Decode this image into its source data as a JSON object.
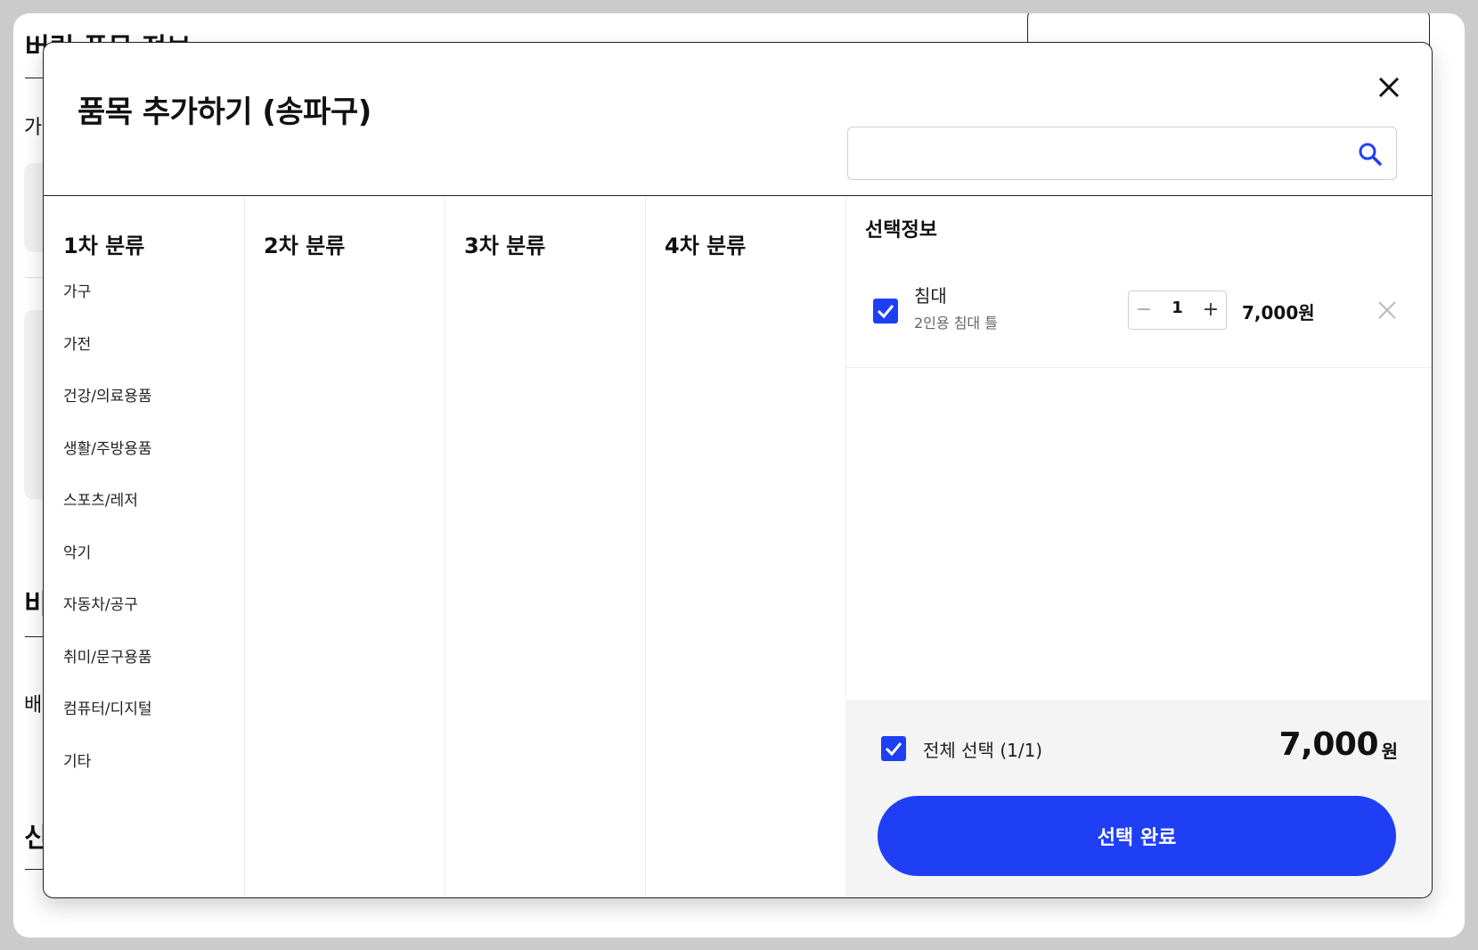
{
  "background": {
    "title": "버림 품목 정보",
    "letter_1": "가",
    "letter_2": "비",
    "letter_3": "배",
    "letter_4": "신"
  },
  "modal": {
    "title": "품목 추가하기 (송파구)",
    "search": {
      "value": "",
      "placeholder": ""
    },
    "columns": {
      "col1_title": "1차 분류",
      "col2_title": "2차 분류",
      "col3_title": "3차 분류",
      "col4_title": "4차 분류"
    },
    "categories": [
      "가구",
      "가전",
      "건강/의료용품",
      "생활/주방용품",
      "스포츠/레저",
      "악기",
      "자동차/공구",
      "취미/문구용품",
      "컴퓨터/디지털",
      "기타"
    ],
    "selection": {
      "title": "선택정보",
      "items": [
        {
          "name": "침대",
          "description": "2인용 침대 틀",
          "quantity": "1",
          "price": "7,000원",
          "checked": true
        }
      ],
      "select_all_label": "전체 선택 (1/1)",
      "total_amount": "7,000",
      "total_unit": "원",
      "complete_label": "선택 완료"
    },
    "colors": {
      "accent": "#1f3ff5",
      "footer_bg": "#f4f4f4"
    },
    "icons": {
      "close": "close-icon",
      "search": "search-icon",
      "remove": "remove-icon",
      "check": "check-icon"
    }
  }
}
